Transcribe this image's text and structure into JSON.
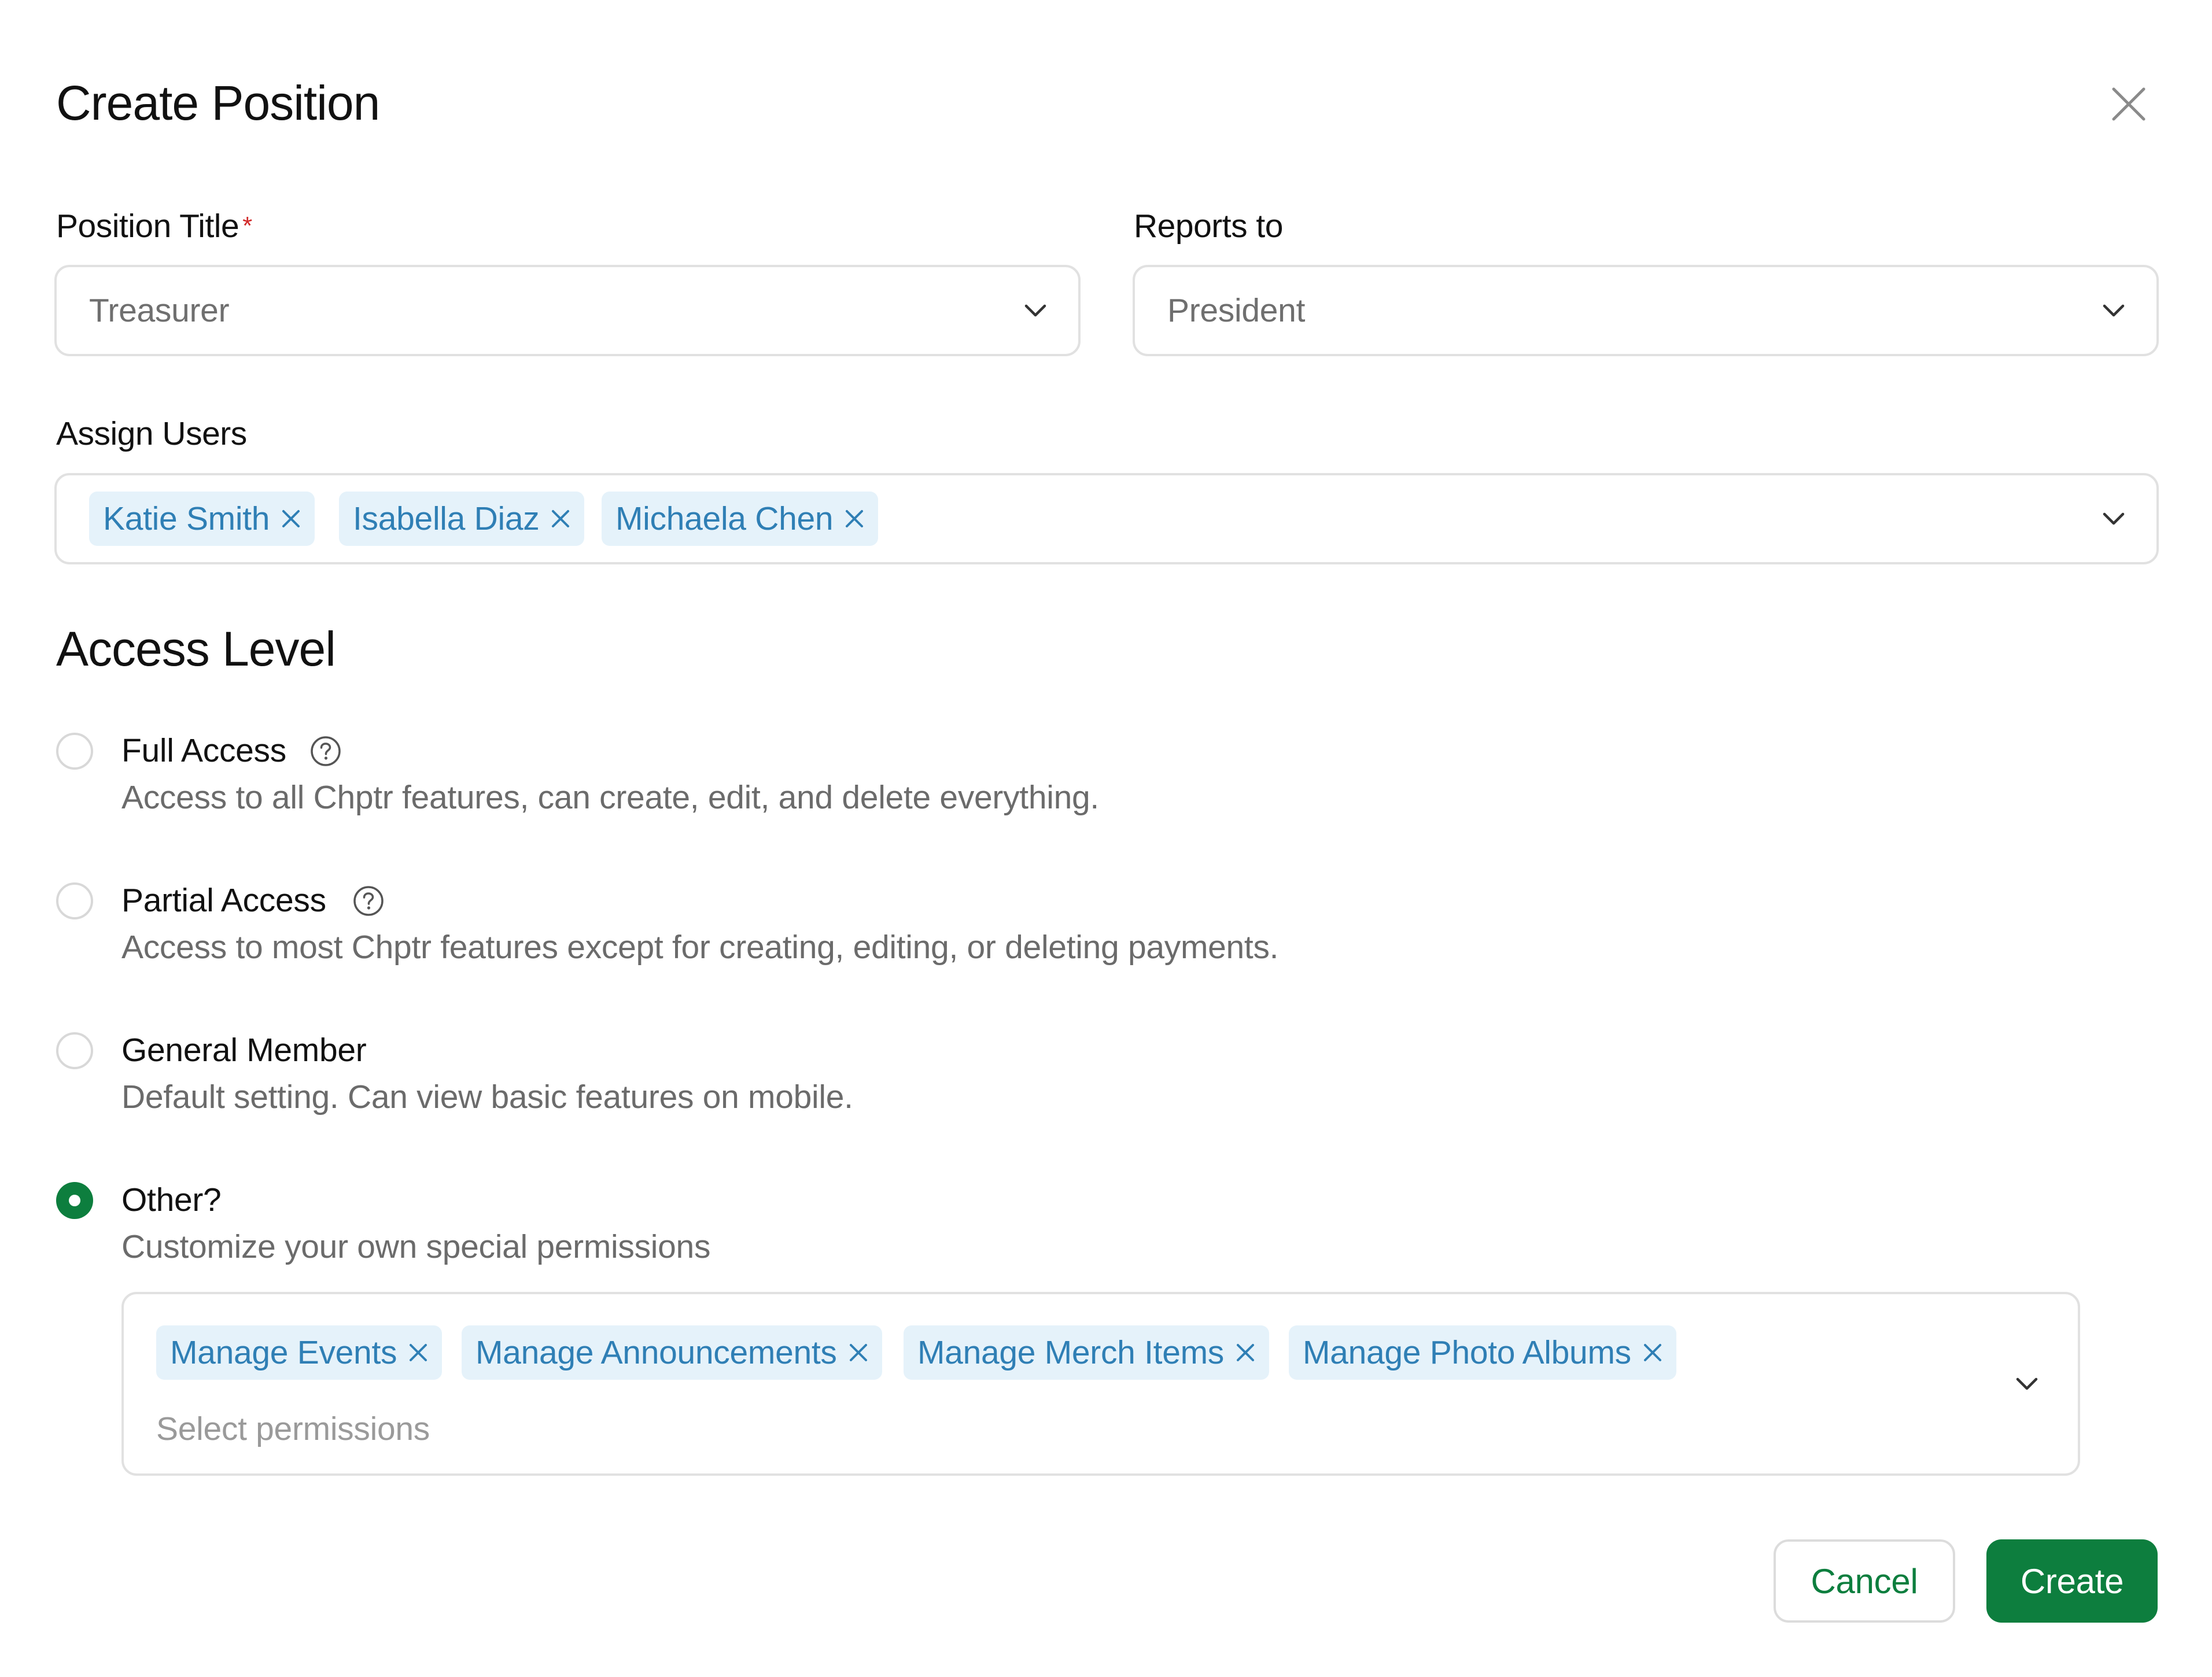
{
  "dialog": {
    "title": "Create Position",
    "close_icon": "close-icon"
  },
  "position_title": {
    "label": "Position Title",
    "required_mark": "*",
    "value": "Treasurer"
  },
  "reports_to": {
    "label": "Reports to",
    "value": "President"
  },
  "assign_users": {
    "label": "Assign Users",
    "users": [
      "Katie Smith",
      "Isabella Diaz",
      "Michaela Chen"
    ]
  },
  "access_level": {
    "title": "Access Level",
    "selected": "other",
    "options": [
      {
        "id": "full",
        "label": "Full Access",
        "description": "Access to all Chptr features, can create, edit, and delete everything.",
        "help_icon": "question-circle-icon"
      },
      {
        "id": "partial",
        "label": "Partial Access",
        "description": "Access to most Chptr features except for creating, editing, or deleting payments.",
        "help_icon": "question-circle-icon"
      },
      {
        "id": "general",
        "label": "General Member",
        "description": "Default setting. Can view basic features on mobile."
      },
      {
        "id": "other",
        "label": "Other?",
        "description": "Customize your own special permissions"
      }
    ]
  },
  "permissions": {
    "selected": [
      "Manage Events",
      "Manage Announcements",
      "Manage Merch Items",
      "Manage Photo Albums"
    ],
    "placeholder": "Select permissions"
  },
  "actions": {
    "cancel_label": "Cancel",
    "create_label": "Create"
  },
  "colors": {
    "primary_green": "#0d7e3e",
    "chip_bg": "#e5f2fa",
    "chip_text": "#2f7fb5",
    "required_red": "#d12a2a",
    "border": "#e1e1e1"
  }
}
